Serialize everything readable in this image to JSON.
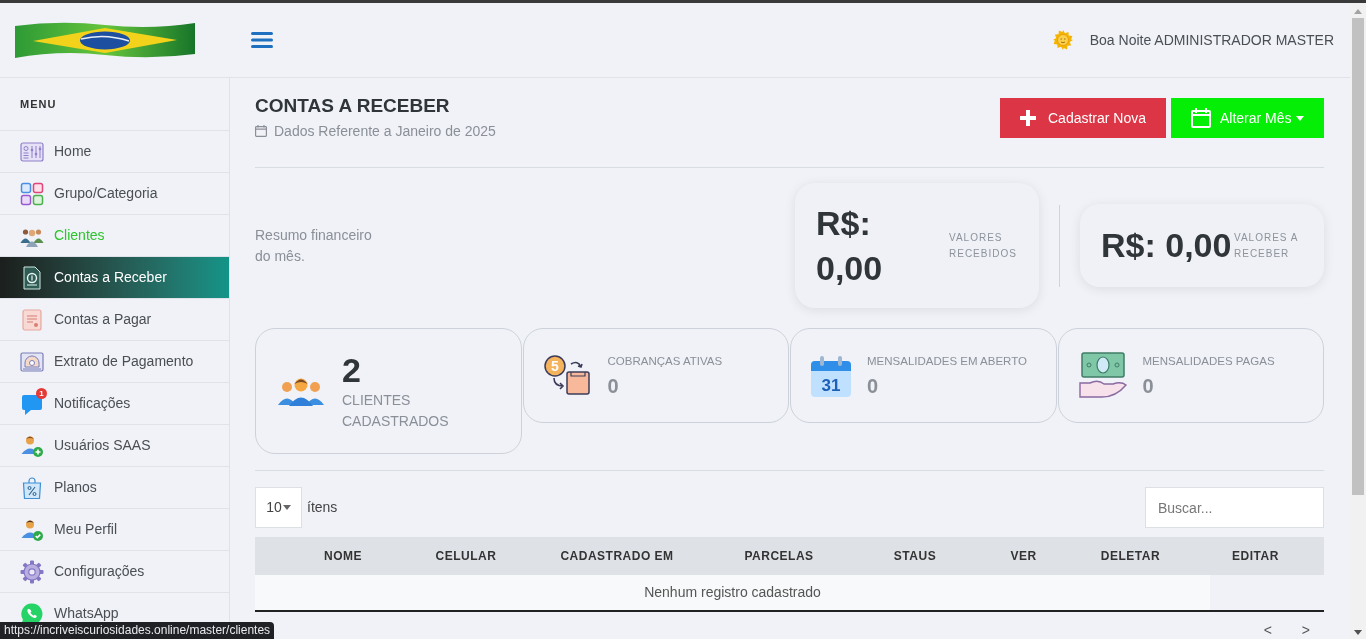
{
  "header": {
    "greeting": "Boa Noite ADMINISTRADOR MASTER"
  },
  "sidebar": {
    "title": "MENU",
    "items": [
      {
        "label": "Home",
        "selected": false,
        "hovered": false
      },
      {
        "label": "Grupo/Categoria",
        "selected": false,
        "hovered": false
      },
      {
        "label": "Clientes",
        "selected": false,
        "hovered": true
      },
      {
        "label": "Contas a Receber",
        "selected": true,
        "hovered": false
      },
      {
        "label": "Contas a Pagar",
        "selected": false,
        "hovered": false
      },
      {
        "label": "Extrato de Pagamento",
        "selected": false,
        "hovered": false
      },
      {
        "label": "Notificações",
        "selected": false,
        "hovered": false,
        "badge": "1"
      },
      {
        "label": "Usuários SAAS",
        "selected": false,
        "hovered": false
      },
      {
        "label": "Planos",
        "selected": false,
        "hovered": false
      },
      {
        "label": "Meu Perfil",
        "selected": false,
        "hovered": false
      },
      {
        "label": "Configurações",
        "selected": false,
        "hovered": false
      },
      {
        "label": "WhatsApp",
        "selected": false,
        "hovered": false
      }
    ]
  },
  "page": {
    "title": "CONTAS A RECEBER",
    "subtitle": "Dados Referente a Janeiro de 2025",
    "actions": [
      {
        "kind": "add",
        "label": "Cadastrar Nova"
      },
      {
        "kind": "month",
        "label": "Alterar Mês"
      }
    ]
  },
  "summary": {
    "text": "Resumo financeiro do mês.",
    "cards": [
      {
        "value": "R$: 0,00",
        "label": "VALORES RECEBIDOS"
      },
      {
        "value": "R$: 0,00",
        "label": "VALORES A RECEBER"
      }
    ]
  },
  "stats": [
    {
      "kind": "count",
      "value": "2",
      "label": "CLIENTES CADASTRADOS"
    },
    {
      "kind": "metric",
      "label": "COBRANÇAS ATIVAS",
      "value": "0",
      "icon_text": "5"
    },
    {
      "kind": "metric",
      "label": "MENSALIDADES EM ABERTO",
      "value": "0",
      "icon_text": "31"
    },
    {
      "kind": "metric",
      "label": "MENSALIDADES PAGAS",
      "value": "0"
    }
  ],
  "table": {
    "page_size": "10",
    "page_size_label": "ítens",
    "search": {
      "placeholder": "Buscar..."
    },
    "columns": [
      "NOME",
      "CELULAR",
      "CADASTRADO EM",
      "PARCELAS",
      "STAUS",
      "VER",
      "DELETAR",
      "EDITAR"
    ],
    "empty_message": "Nenhum registro cadastrado",
    "pagination": {
      "previous": "<",
      "next": ">"
    }
  },
  "status_url": "https://incriveiscuriosidades.online/master/clientes"
}
